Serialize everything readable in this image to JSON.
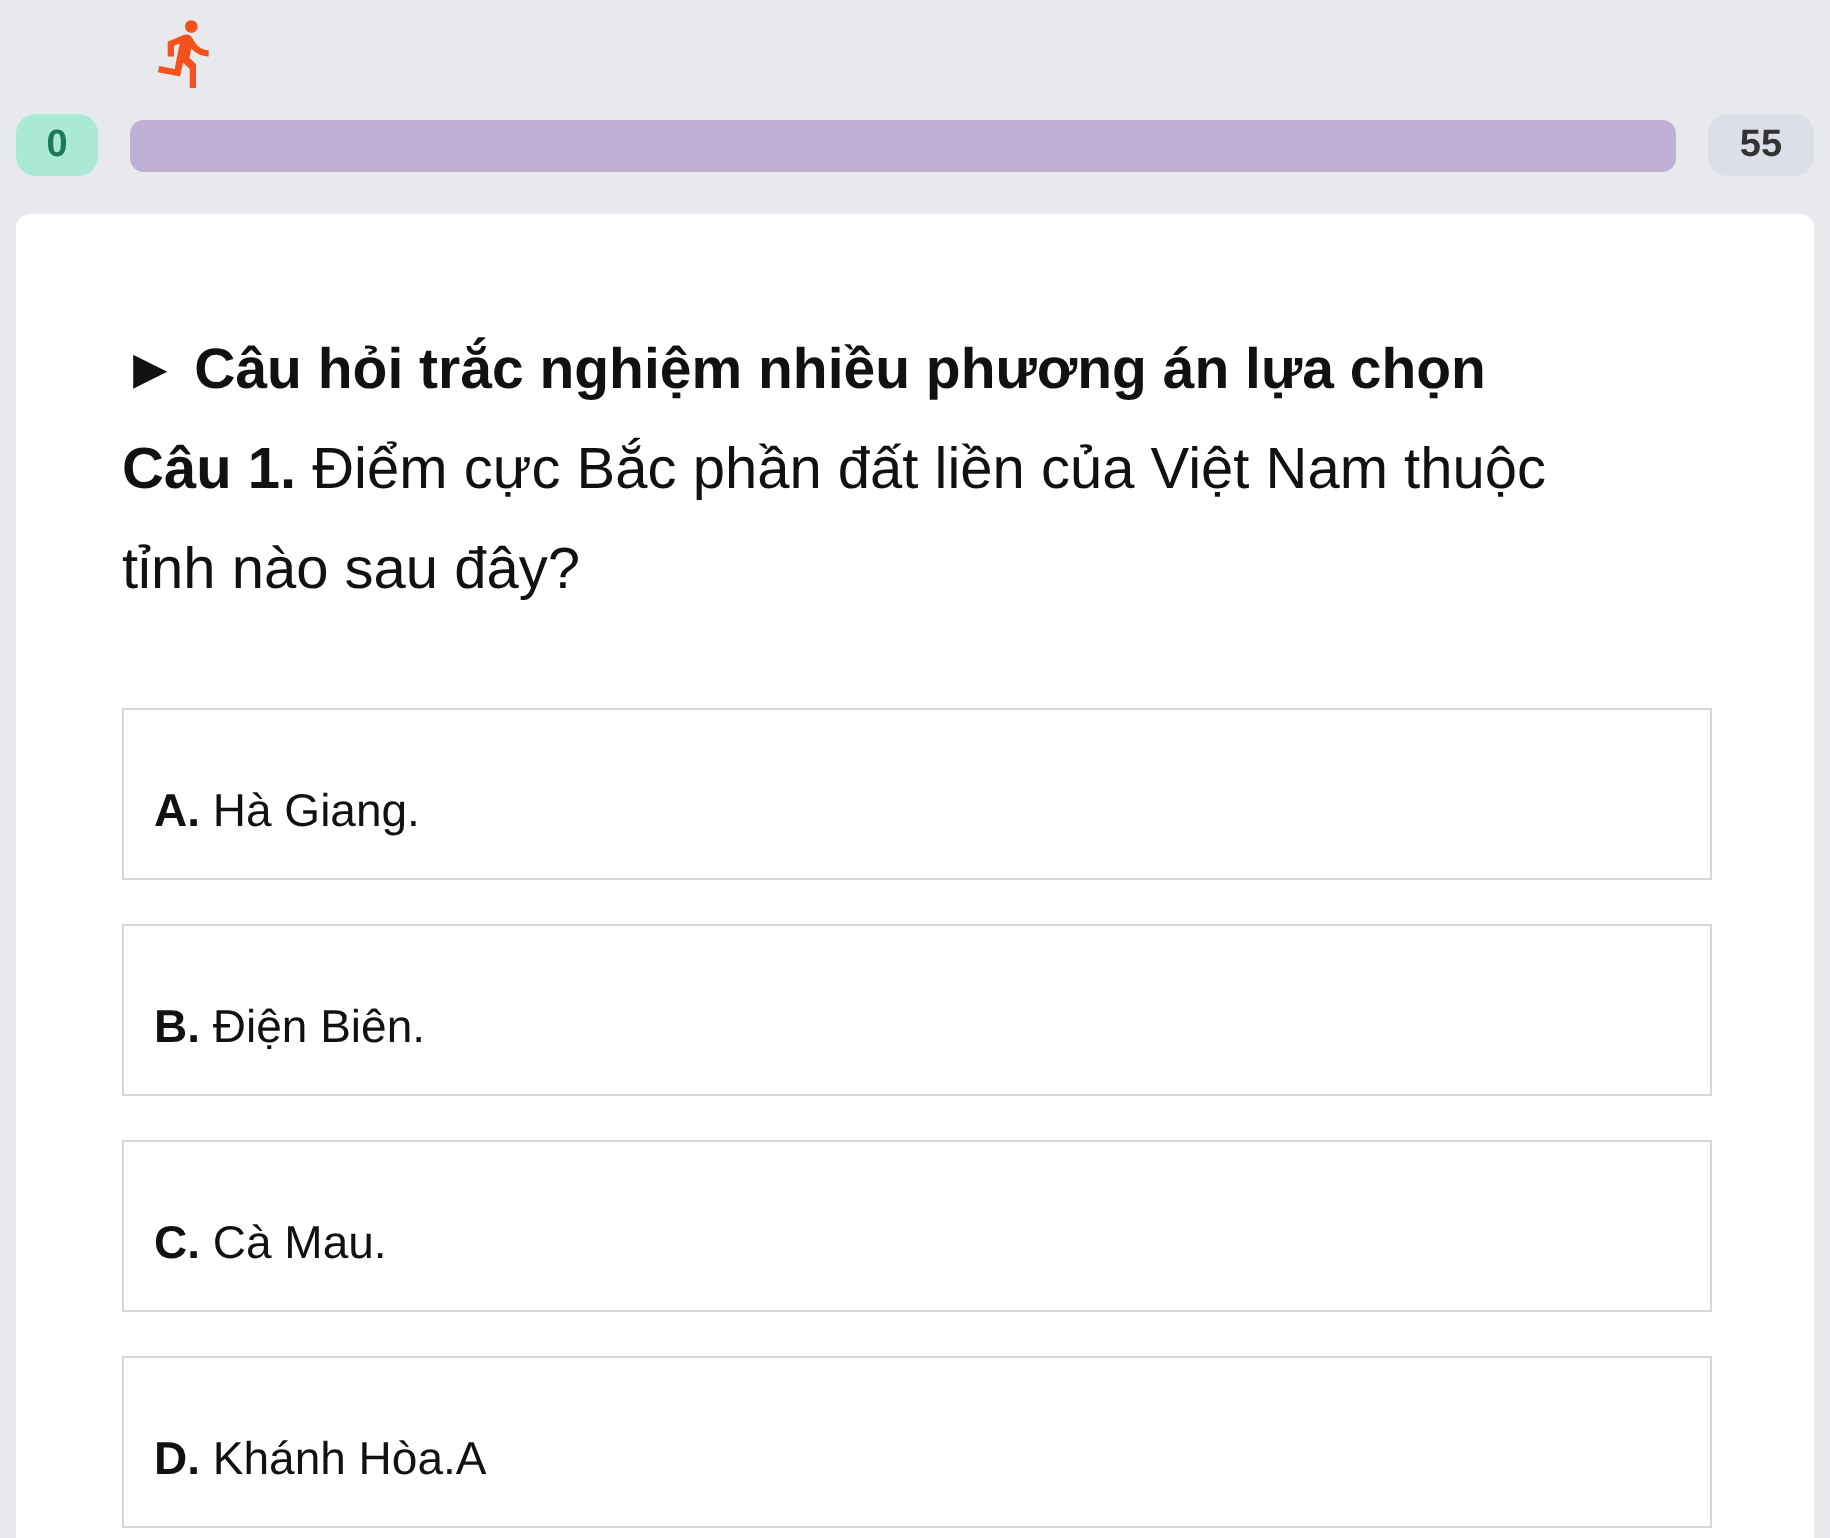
{
  "progress": {
    "start": "0",
    "end": "55",
    "level": 0
  },
  "question_card": {
    "title": "► Câu hỏi trắc nghiệm nhiều phương án lựa chọn",
    "question": "**Câu 1.** Điểm cực Bắc phần đất liền của Việt Nam thuộc tỉnh nào sau đây?",
    "options": [
      {
        "text": "**A.** Hà Giang.",
        "selected": false
      },
      {
        "text": "**B.** Điện Biên.",
        "selected": false
      },
      {
        "text": "**C.** Cà Mau.",
        "selected": false
      },
      {
        "text": "**D.** Khánh Hòa.A",
        "selected": false
      }
    ]
  }
}
